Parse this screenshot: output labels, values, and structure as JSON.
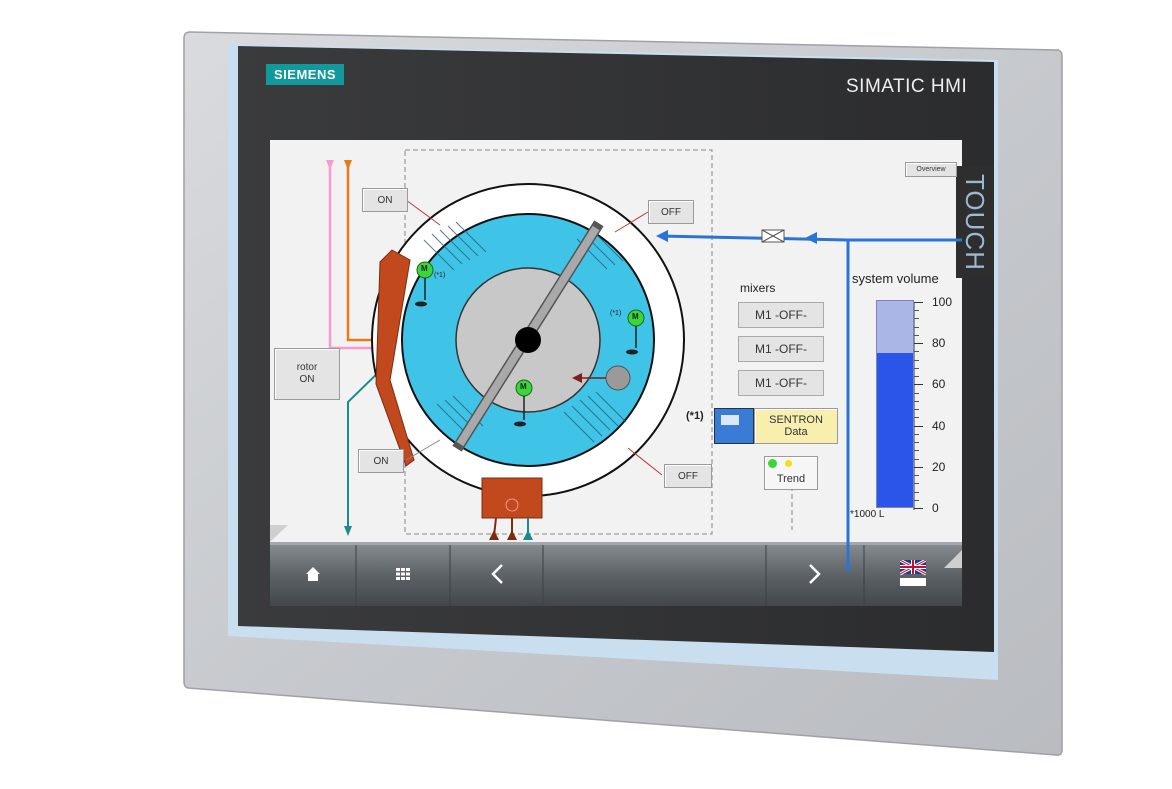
{
  "device": {
    "brand": "SIEMENS",
    "product": "SIMATIC HMI",
    "side_label": "TOUCH"
  },
  "screen": {
    "overview_button": "Overview",
    "rotor_button": "rotor\nON",
    "on_button_top": "ON",
    "on_button_bottom": "ON",
    "off_button_top": "OFF",
    "off_button_bottom": "OFF",
    "motor_label": "M",
    "note_mark_small": "(*1)",
    "mixers": {
      "heading": "mixers",
      "items": [
        {
          "label": "M1 -OFF-"
        },
        {
          "label": "M1 -OFF-"
        },
        {
          "label": "M1 -OFF-"
        }
      ]
    },
    "sentron": {
      "note": "(*1)",
      "label": "SENTRON\nData"
    },
    "trend_button": "Trend",
    "system_volume": {
      "title": "system volume",
      "unit": "*1000 L",
      "ticks": [
        "100",
        "80",
        "60",
        "40",
        "20",
        "0"
      ],
      "level_percent": 75,
      "fill_color": "#2a55e8",
      "empty_color": "#a9b6e6"
    },
    "colors": {
      "basin": "#3fc3e6",
      "rotor_core": "#c8c8c8",
      "heater": "#c2481d",
      "pipe_blue": "#2a74d8"
    }
  },
  "nav_bar": {
    "home": "home-icon",
    "menu": "grid-icon",
    "back": "chevron-left-icon",
    "forward": "chevron-right-icon",
    "language": "uk-flag-icon"
  }
}
